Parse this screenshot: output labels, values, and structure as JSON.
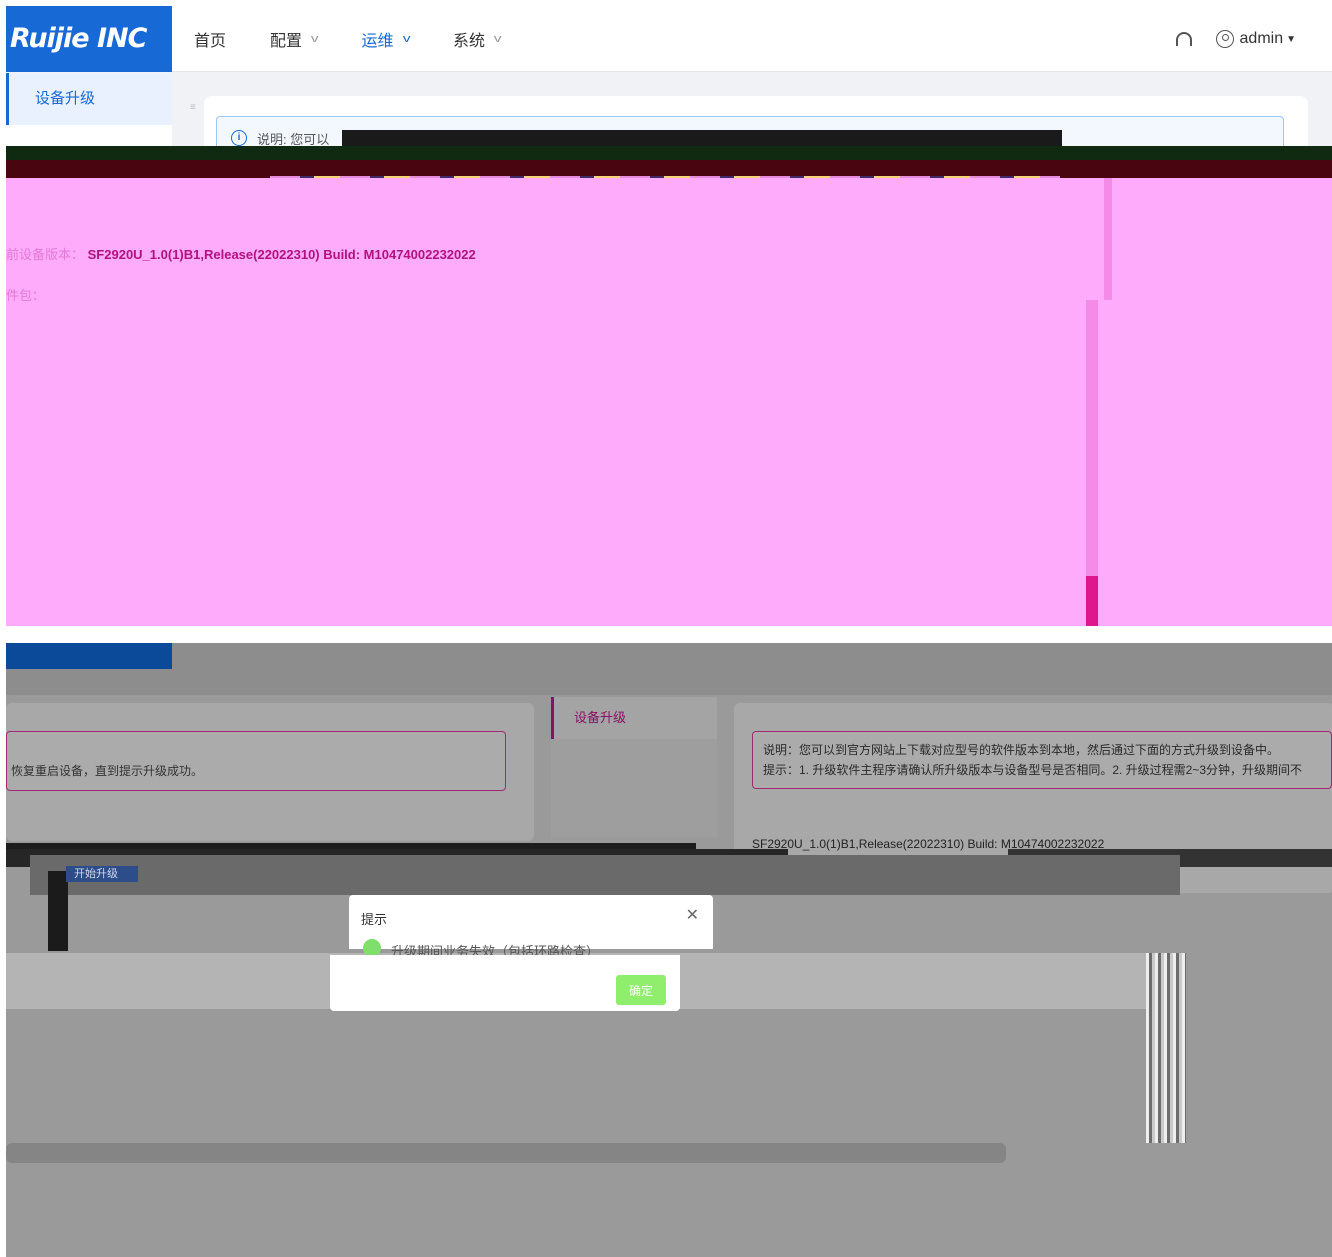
{
  "brand": {
    "logo_text": "Ruijie INC"
  },
  "nav": {
    "items": [
      {
        "label": "首页",
        "has_dropdown": false,
        "active": false
      },
      {
        "label": "配置",
        "has_dropdown": true,
        "active": false
      },
      {
        "label": "运维",
        "has_dropdown": true,
        "active": true
      },
      {
        "label": "系统",
        "has_dropdown": true,
        "active": false
      }
    ],
    "user": "admin"
  },
  "sidebar": {
    "items": [
      {
        "label": "设备升级",
        "active": true
      }
    ]
  },
  "notice": {
    "prefix": "说明: 您可以",
    "full": "说明：您可以到官方网站上下载对应型号的软件版本到本地，然后通过下面的方式升级到设备中。",
    "tip": "提示：1. 升级软件主程序请确认所升级版本与设备型号是否相同。2. 升级过程需2~3分钟，升级期间不"
  },
  "version": {
    "label": "前设备版本：",
    "value": "SF2920U_1.0(1)B1,Release(22022310) Build: M10474002232022"
  },
  "package": {
    "label": "件包："
  },
  "dim_text": {
    "restart_hint": "恢复重启设备，直到提示升级成功。"
  },
  "buttons": {
    "start_upgrade": "开始升级"
  },
  "dialog": {
    "title": "提示",
    "message": "升级期间业务失效（包括环路检查）",
    "ok_label": "确定"
  },
  "colors": {
    "brand_blue": "#1769d6",
    "glitch_magenta": "#ffabfb",
    "ok_green": "#90ee6d"
  }
}
